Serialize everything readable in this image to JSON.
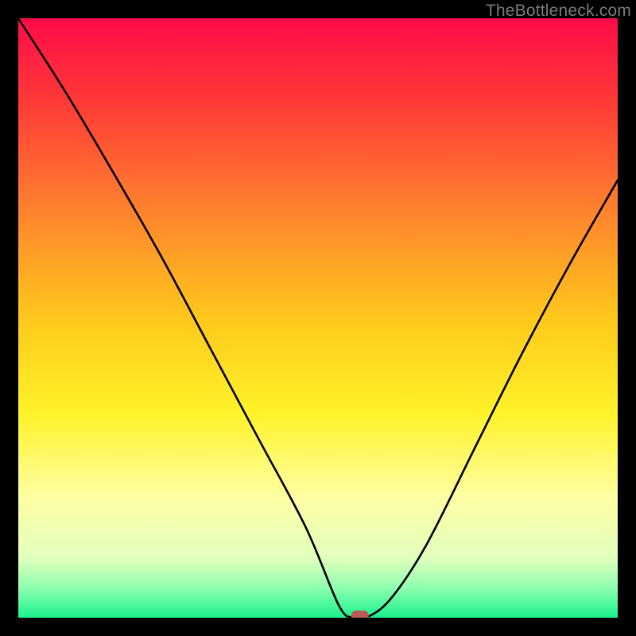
{
  "watermark": "TheBottleneck.com",
  "chart_data": {
    "type": "line",
    "title": "",
    "xlabel": "",
    "ylabel": "",
    "xlim": [
      0,
      100
    ],
    "ylim": [
      0,
      100
    ],
    "grid": false,
    "legend": false,
    "series": [
      {
        "name": "bottleneck-curve",
        "x": [
          0,
          8,
          16,
          24,
          32,
          40,
          48,
          53.5,
          56,
          58,
          62,
          68,
          76,
          84,
          92,
          100
        ],
        "values": [
          100,
          87.5,
          74,
          60,
          45,
          30,
          15,
          2,
          0,
          0,
          3,
          12,
          28,
          44,
          59,
          73
        ]
      }
    ],
    "marker": {
      "x": 57,
      "y": 0,
      "color": "#b85a56"
    },
    "gradient_stops": [
      {
        "pct": 0,
        "color": "#ff0b49"
      },
      {
        "pct": 14,
        "color": "#ff3a37"
      },
      {
        "pct": 30,
        "color": "#ff7a2f"
      },
      {
        "pct": 50,
        "color": "#ffc81c"
      },
      {
        "pct": 66,
        "color": "#fff32a"
      },
      {
        "pct": 80,
        "color": "#feffa4"
      },
      {
        "pct": 90,
        "color": "#e2ffbd"
      },
      {
        "pct": 95,
        "color": "#8fffb0"
      },
      {
        "pct": 100,
        "color": "#19f18e"
      }
    ]
  }
}
